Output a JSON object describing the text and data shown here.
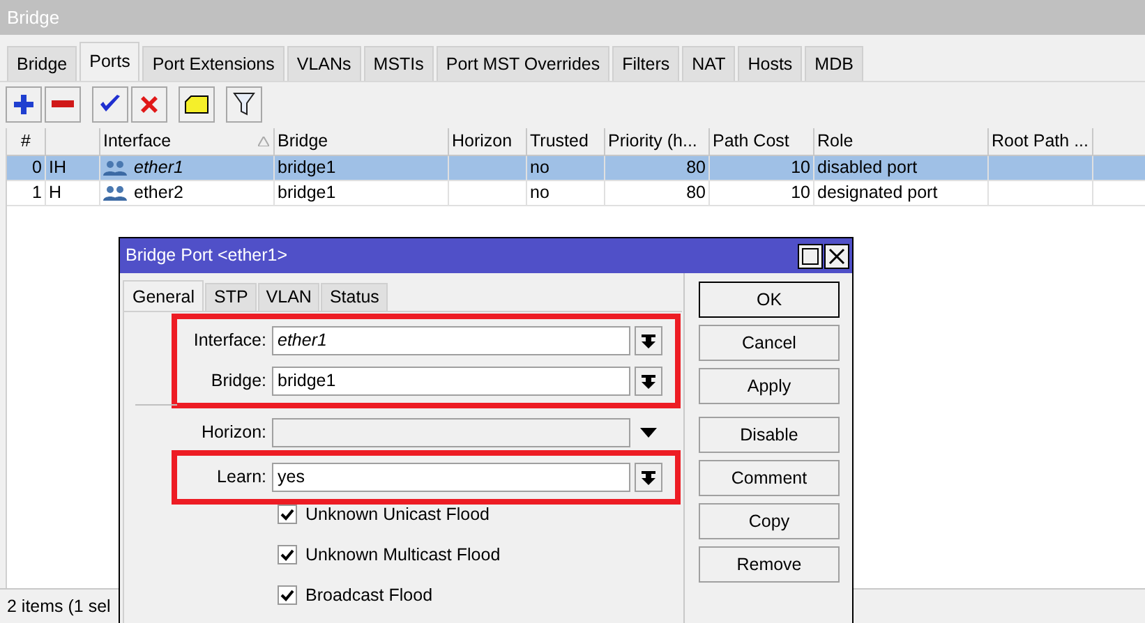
{
  "window": {
    "title": "Bridge"
  },
  "tabs": [
    {
      "label": "Bridge",
      "selected": false
    },
    {
      "label": "Ports",
      "selected": true
    },
    {
      "label": "Port Extensions",
      "selected": false
    },
    {
      "label": "VLANs",
      "selected": false
    },
    {
      "label": "MSTIs",
      "selected": false
    },
    {
      "label": "Port MST Overrides",
      "selected": false
    },
    {
      "label": "Filters",
      "selected": false
    },
    {
      "label": "NAT",
      "selected": false
    },
    {
      "label": "Hosts",
      "selected": false
    },
    {
      "label": "MDB",
      "selected": false
    }
  ],
  "toolbar": [
    {
      "kind": "add"
    },
    {
      "kind": "remove"
    },
    {
      "kind": "enable"
    },
    {
      "kind": "disable"
    },
    {
      "kind": "comment"
    },
    {
      "kind": "filter"
    }
  ],
  "table": {
    "columns": [
      {
        "label": "#",
        "sorted": false
      },
      {
        "sorted": false
      },
      {
        "label": "Interface",
        "sorted": true
      },
      {
        "label": "Bridge",
        "sorted": false
      },
      {
        "label": "Horizon",
        "sorted": false
      },
      {
        "label": "Trusted",
        "sorted": false
      },
      {
        "label": "Priority (h...",
        "sorted": false
      },
      {
        "label": "Path Cost",
        "sorted": false
      },
      {
        "label": "Role",
        "sorted": false
      },
      {
        "label": "Root Path ...",
        "sorted": false
      }
    ],
    "rows": [
      {
        "selected": true,
        "disabled": true,
        "cells": [
          "0",
          "IH",
          "ether1",
          "bridge1",
          "",
          "no",
          "80",
          "10",
          "disabled port",
          ""
        ]
      },
      {
        "selected": false,
        "disabled": false,
        "cells": [
          "1",
          "H",
          "ether2",
          "bridge1",
          "",
          "no",
          "80",
          "10",
          "designated port",
          ""
        ]
      }
    ]
  },
  "status_bar": {
    "text": "2 items (1 sel"
  },
  "dialog": {
    "title": "Bridge Port <ether1>",
    "tabs": [
      {
        "label": "General",
        "selected": true
      },
      {
        "label": "STP",
        "selected": false
      },
      {
        "label": "VLAN",
        "selected": false
      },
      {
        "label": "Status",
        "selected": false
      }
    ],
    "field_groups": [
      {
        "highlighted": true,
        "fields": [
          {
            "label": "Interface:",
            "value": "ether1",
            "italic": true,
            "kind": "combo"
          },
          {
            "label": "Bridge:",
            "value": "bridge1",
            "italic": false,
            "kind": "combo"
          }
        ]
      },
      {
        "highlighted": false,
        "fields": [
          {
            "label": "Horizon:",
            "kind": "optional"
          }
        ]
      },
      {
        "highlighted": true,
        "fields": [
          {
            "label": "Learn:",
            "value": "yes",
            "italic": false,
            "kind": "combo"
          }
        ]
      }
    ],
    "checkboxes": [
      {
        "label": "Unknown Unicast Flood",
        "checked": true
      },
      {
        "label": "Unknown Multicast Flood",
        "checked": true
      },
      {
        "label": "Broadcast Flood",
        "checked": true
      }
    ],
    "buttons": [
      {
        "label": "OK",
        "default": true
      },
      {
        "label": "Cancel",
        "default": false
      },
      {
        "label": "Apply",
        "default": false
      },
      {
        "label": "Disable",
        "default": false
      },
      {
        "label": "Comment",
        "default": false
      },
      {
        "label": "Copy",
        "default": false
      },
      {
        "label": "Remove",
        "default": false
      }
    ]
  }
}
